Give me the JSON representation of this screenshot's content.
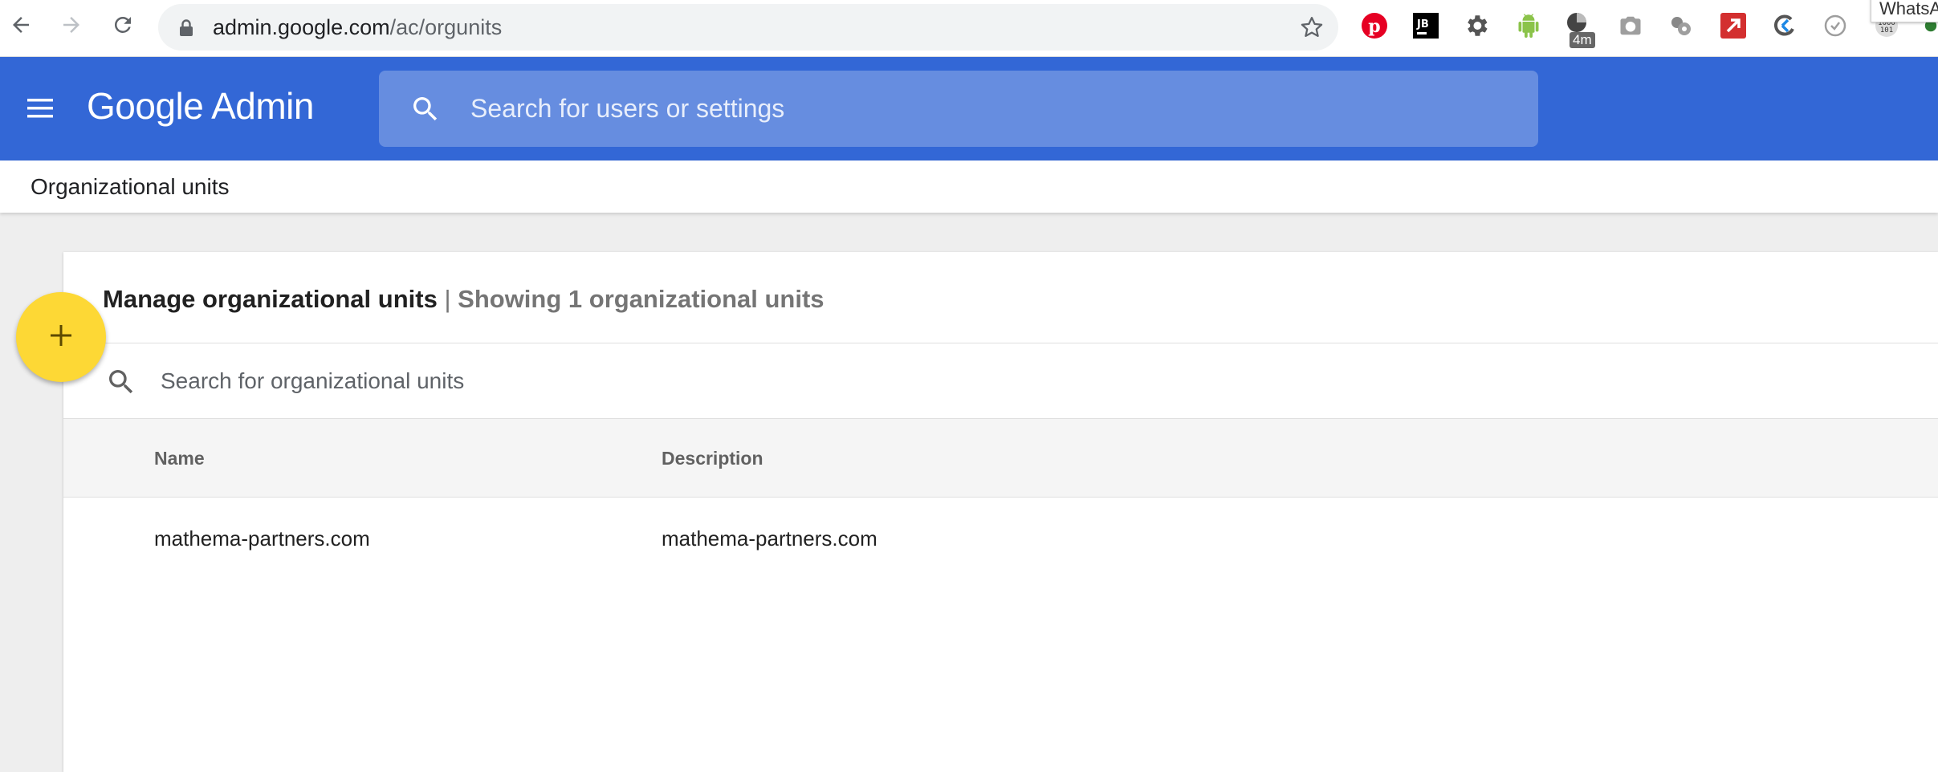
{
  "browser": {
    "url_host": "admin.google.com",
    "url_path": "/ac/orgunits",
    "extension_badge": "4m",
    "tooltip": "WhatsA"
  },
  "header": {
    "logo_google": "Google",
    "logo_admin": "Admin",
    "search_placeholder": "Search for users or settings",
    "color": "#3367d6"
  },
  "breadcrumb": {
    "title": "Organizational units"
  },
  "card": {
    "heading": "Manage organizational units",
    "separator": "|",
    "subheading": "Showing 1 organizational units",
    "search_placeholder": "Search for organizational units",
    "columns": [
      "Name",
      "Description"
    ],
    "rows": [
      {
        "name": "mathema-partners.com",
        "description": "mathema-partners.com"
      }
    ]
  },
  "fab": {
    "icon": "plus-icon",
    "color": "#fdd835"
  }
}
